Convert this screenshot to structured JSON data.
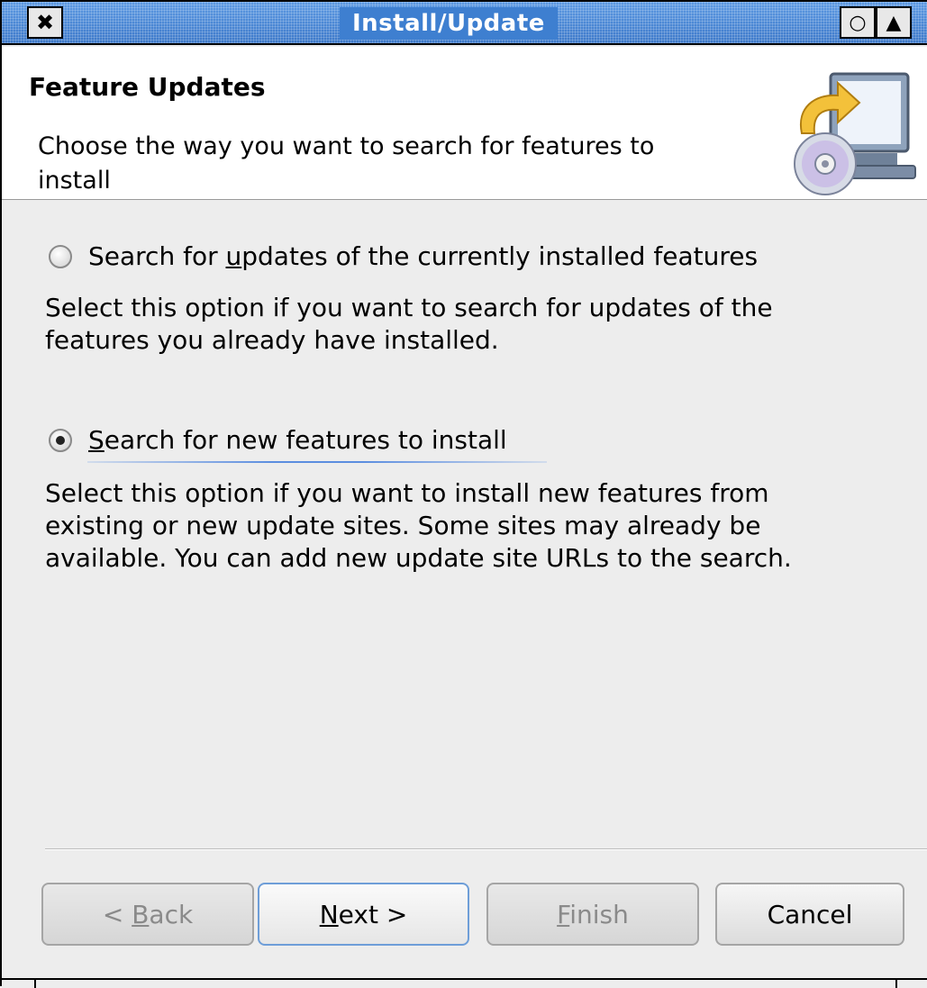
{
  "window": {
    "title": "Install/Update",
    "close_glyph": "✖",
    "minimize_glyph": "○",
    "maximize_glyph": "▲"
  },
  "banner": {
    "title": "Feature Updates",
    "description_line1": "Choose the way you want to search for features to",
    "description_line2": "install",
    "icon": "install-update-wizard-icon"
  },
  "options": [
    {
      "label_prefix": "Search for ",
      "label_mnemonic": "u",
      "label_suffix": "pdates of the currently installed features",
      "selected": false,
      "description_line1": "Select this option if you want to search for updates of the",
      "description_line2": "features you already have installed."
    },
    {
      "label_prefix": "",
      "label_mnemonic": "S",
      "label_suffix": "earch for new features to install",
      "selected": true,
      "description_line1": "Select this option if you want to install new features from",
      "description_line2": "existing or new update sites. Some sites may already be",
      "description_line3": "available. You can add new update site URLs to the search."
    }
  ],
  "buttons": {
    "back_prefix": "< ",
    "back_mnemonic": "B",
    "back_suffix": "ack",
    "next_mnemonic": "N",
    "next_suffix": "ext >",
    "finish_mnemonic": "F",
    "finish_suffix": "inish",
    "cancel_label": "Cancel"
  },
  "colors": {
    "titlebar": "#4a89d6",
    "dialog_bg": "#ededed",
    "focus_accent": "#5c8ee0"
  }
}
